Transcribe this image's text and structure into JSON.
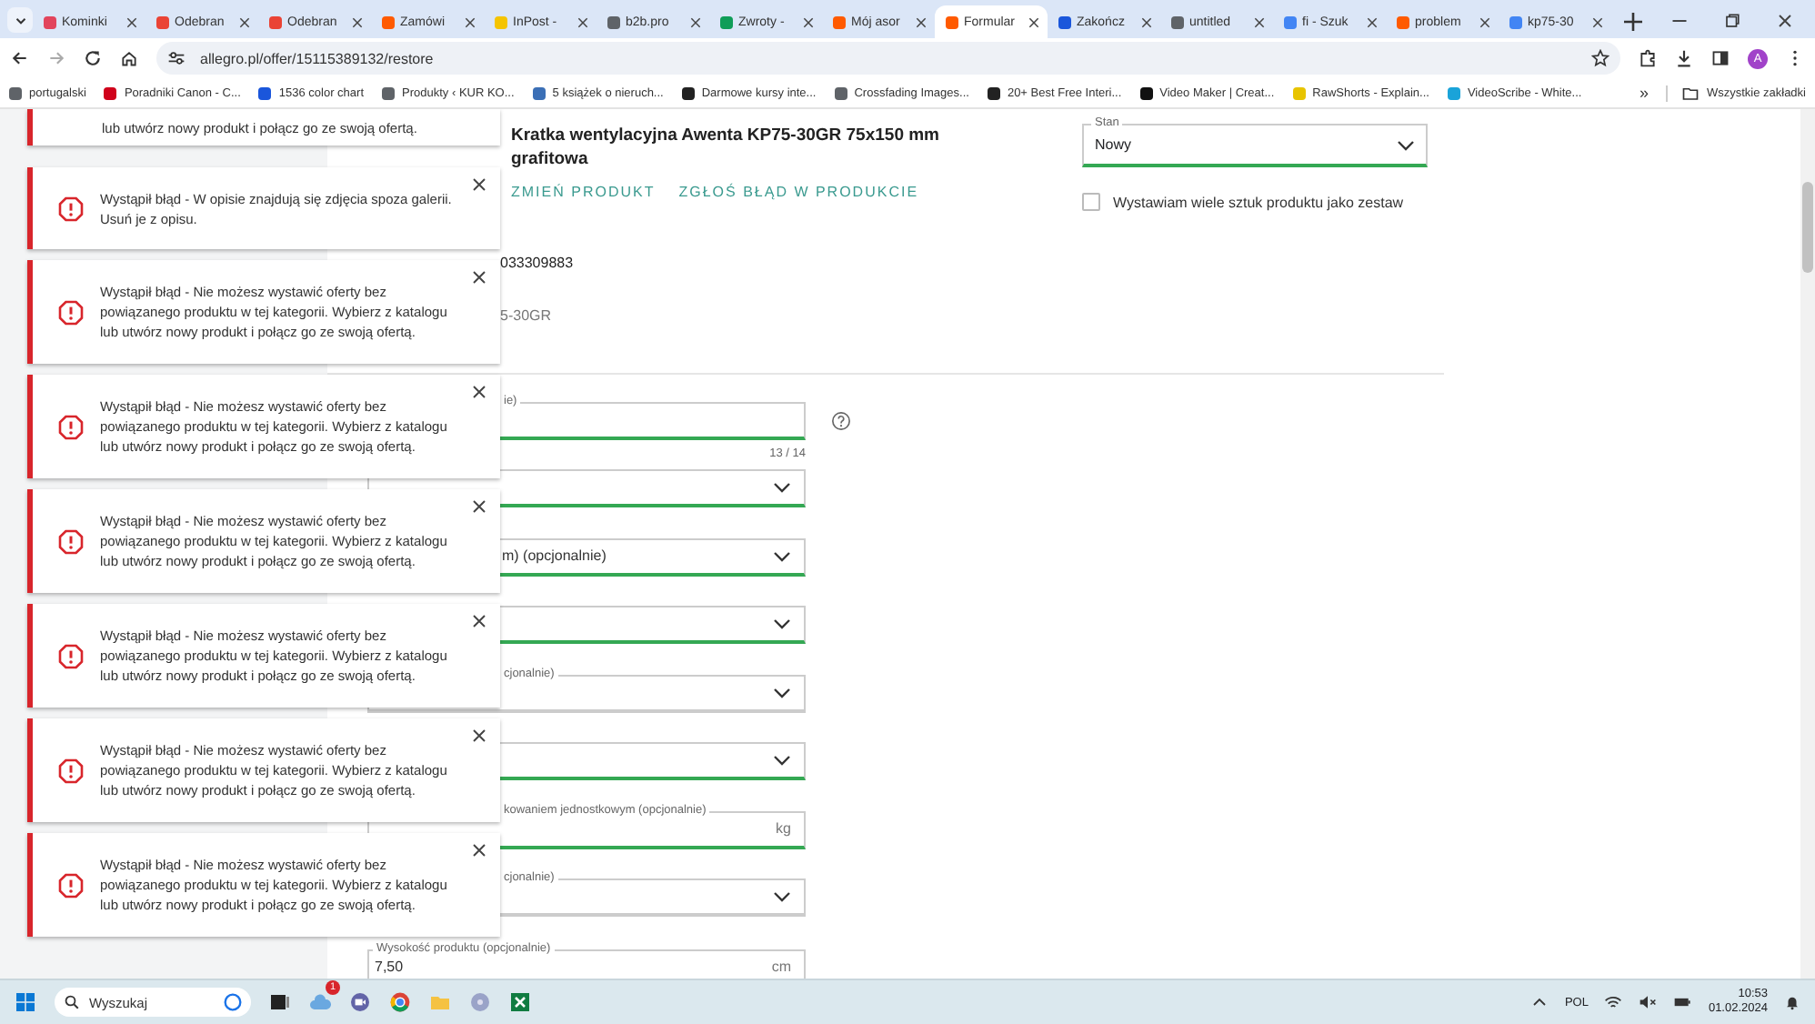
{
  "browser": {
    "tabs": [
      {
        "label": "Kominki",
        "selected": false,
        "color": "#e2445c"
      },
      {
        "label": "Odebran",
        "selected": false,
        "color": "#ea4335"
      },
      {
        "label": "Odebran",
        "selected": false,
        "color": "#ea4335"
      },
      {
        "label": "Zamówi",
        "selected": false,
        "color": "#ff5a00"
      },
      {
        "label": "InPost - ",
        "selected": false,
        "color": "#f5c400"
      },
      {
        "label": "b2b.pro",
        "selected": false,
        "color": "#5f6368"
      },
      {
        "label": "Zwroty -",
        "selected": false,
        "color": "#0f9d58"
      },
      {
        "label": "Mój asor",
        "selected": false,
        "color": "#ff5a00"
      },
      {
        "label": "Formular",
        "selected": true,
        "color": "#ff5a00"
      },
      {
        "label": "Zakończ",
        "selected": false,
        "color": "#1a56db"
      },
      {
        "label": "untitled",
        "selected": false,
        "color": "#5f6368"
      },
      {
        "label": "fi - Szuk",
        "selected": false,
        "color": "#4285f4"
      },
      {
        "label": "problem",
        "selected": false,
        "color": "#ff5a00"
      },
      {
        "label": "kp75-30",
        "selected": false,
        "color": "#4285f4"
      }
    ],
    "address": "allegro.pl/offer/15115389132/restore",
    "profile_initial": "A",
    "bookmarks": [
      {
        "label": "portugalski",
        "color": "#5f6368"
      },
      {
        "label": "Poradniki Canon - C...",
        "color": "#d0021b"
      },
      {
        "label": "1536 color chart",
        "color": "#1a56db"
      },
      {
        "label": "Produkty ‹ KUR KO...",
        "color": "#5f6368"
      },
      {
        "label": "5 książek o nieruch...",
        "color": "#3b6fb6"
      },
      {
        "label": "Darmowe kursy inte...",
        "color": "#222222"
      },
      {
        "label": "Crossfading Images...",
        "color": "#5f6368"
      },
      {
        "label": "20+ Best Free Interi...",
        "color": "#222222"
      },
      {
        "label": "Video Maker | Creat...",
        "color": "#111111"
      },
      {
        "label": "RawShorts - Explain...",
        "color": "#e8c400"
      },
      {
        "label": "VideoScribe - White...",
        "color": "#1aa3d9"
      }
    ],
    "bookmarks_more": "»",
    "all_bookmarks": "Wszystkie zakładki"
  },
  "product": {
    "title": "Kratka wentylacyjna Awenta KP75-30GR 75x150 mm grafitowa",
    "links": [
      "ZMIEŃ PRODUKT",
      "ZGŁOŚ BŁĄD W PRODUKCIE"
    ],
    "code_fragment": "033309883",
    "model_fragment": "5-30GR"
  },
  "condition": {
    "label": "Stan",
    "value": "Nowy"
  },
  "set_option": {
    "label": "Wystawiam wiele sztuk produktu jako zestaw",
    "checked": false
  },
  "fields": [
    {
      "kind": "input",
      "label": "ie)",
      "valid": true,
      "counter": "13 / 14",
      "help": true
    },
    {
      "kind": "select",
      "valid": true
    },
    {
      "kind": "select",
      "value": "m) (opcjonalnie)",
      "valid": true
    },
    {
      "kind": "select",
      "valid": true
    },
    {
      "kind": "select",
      "label": "cjonalnie)",
      "valid": false
    },
    {
      "kind": "select",
      "valid": true
    },
    {
      "kind": "input",
      "label": "kowaniem jednostkowym (opcjonalnie)",
      "unit": "kg",
      "valid": true
    },
    {
      "kind": "select",
      "label": "cjonalnie)",
      "valid": false
    },
    {
      "kind": "input",
      "label": "Wysokość produktu (opcjonalnie)",
      "value": "7,50",
      "unit": "cm"
    }
  ],
  "toasts": [
    {
      "message": "lub utwórz nowy produkt i połącz go ze swoją ofertą.",
      "partial": true
    },
    {
      "message": "Wystąpił błąd - W opisie znajdują się zdjęcia spoza galerii. Usuń je z opisu.",
      "partial": false
    },
    {
      "message": "Wystąpił błąd - Nie możesz wystawić oferty bez powiązanego produktu w tej kategorii. Wybierz z katalogu lub utwórz nowy produkt i połącz go ze swoją ofertą.",
      "partial": false
    },
    {
      "message": "Wystąpił błąd - Nie możesz wystawić oferty bez powiązanego produktu w tej kategorii. Wybierz z katalogu lub utwórz nowy produkt i połącz go ze swoją ofertą.",
      "partial": false
    },
    {
      "message": "Wystąpił błąd - Nie możesz wystawić oferty bez powiązanego produktu w tej kategorii. Wybierz z katalogu lub utwórz nowy produkt i połącz go ze swoją ofertą.",
      "partial": false
    },
    {
      "message": "Wystąpił błąd - Nie możesz wystawić oferty bez powiązanego produktu w tej kategorii. Wybierz z katalogu lub utwórz nowy produkt i połącz go ze swoją ofertą.",
      "partial": false
    },
    {
      "message": "Wystąpił błąd - Nie możesz wystawić oferty bez powiązanego produktu w tej kategorii. Wybierz z katalogu lub utwórz nowy produkt i połącz go ze swoją ofertą.",
      "partial": false
    },
    {
      "message": "Wystąpił błąd - Nie możesz wystawić oferty bez powiązanego produktu w tej kategorii. Wybierz z katalogu lub utwórz nowy produkt i połącz go ze swoją ofertą.",
      "partial": false
    }
  ],
  "taskbar": {
    "search_placeholder": "Wyszukaj",
    "badge": "1",
    "language": "POL",
    "time": "10:53",
    "date": "01.02.2024"
  }
}
